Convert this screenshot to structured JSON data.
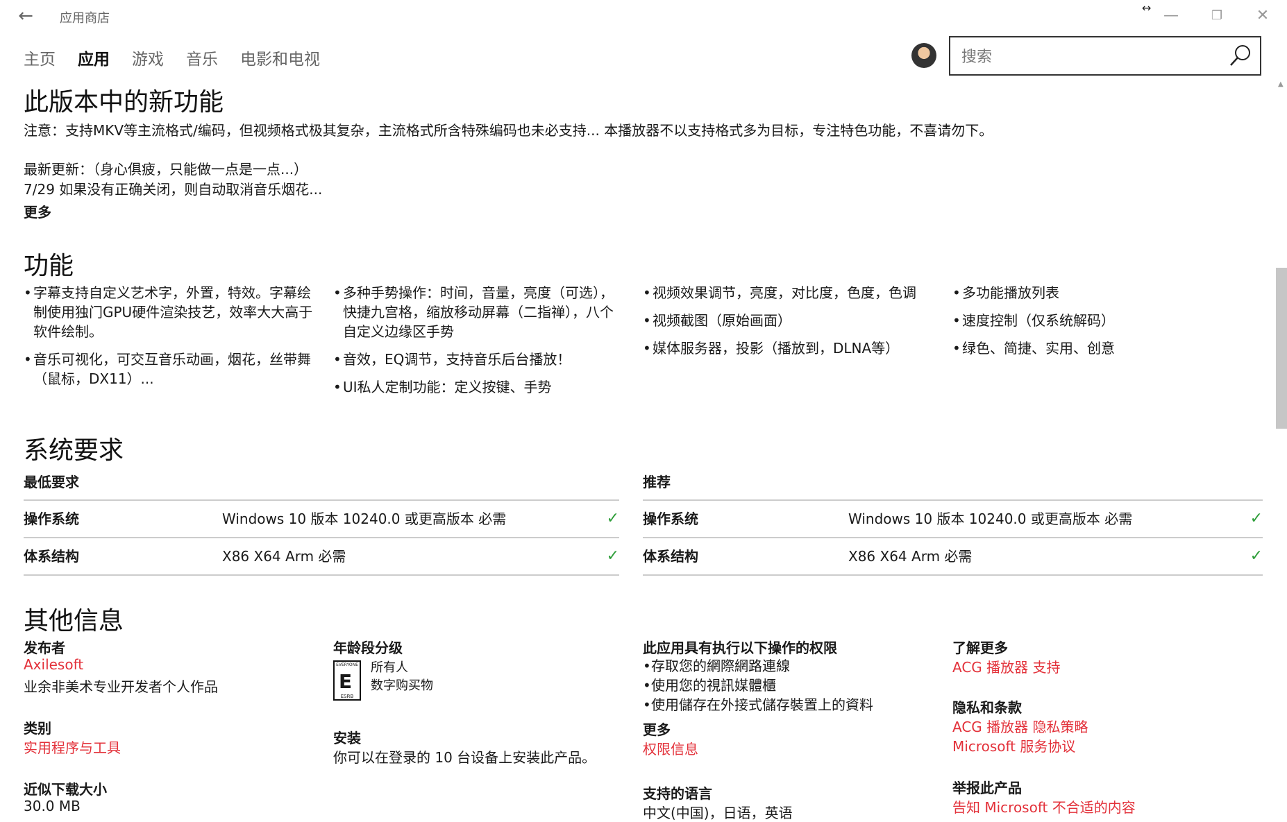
{
  "window": {
    "title": "应用商店"
  },
  "nav": {
    "tabs": [
      {
        "label": "主页"
      },
      {
        "label": "应用"
      },
      {
        "label": "游戏"
      },
      {
        "label": "音乐"
      },
      {
        "label": "电影和电视"
      }
    ],
    "active_index": 1
  },
  "search": {
    "placeholder": "搜索",
    "value": ""
  },
  "whats_new": {
    "heading": "此版本中的新功能",
    "note": "注意：支持MKV等主流格式/编码，但视频格式极其复杂，主流格式所含特殊编码也未必支持... 本播放器不以支持格式多为目标，专注特色功能，不喜请勿下。",
    "latest": "最新更新：（身心俱疲，只能做一点是一点...）",
    "update_line": "7/29 如果没有正确关闭，则自动取消音乐烟花...",
    "more": "更多"
  },
  "features": {
    "heading": "功能",
    "columns": [
      [
        "字幕支持自定义艺术字，外置，特效。字幕绘制使用独门GPU硬件渲染技艺，效率大大高于软件绘制。",
        "音乐可视化，可交互音乐动画，烟花，丝带舞（鼠标，DX11）..."
      ],
      [
        "多种手势操作：时间，音量，亮度（可选），快捷九宫格，缩放移动屏幕（二指禅），八个自定义边缘区手势",
        "音效，EQ调节，支持音乐后台播放！",
        "UI私人定制功能：定义按键、手势"
      ],
      [
        "视频效果调节，亮度，对比度，色度，色调",
        "视频截图（原始画面）",
        "媒体服务器，投影（播放到，DLNA等）"
      ],
      [
        "多功能播放列表",
        "速度控制（仅系统解码）",
        "绿色、简捷、实用、创意"
      ]
    ]
  },
  "sysreq": {
    "heading": "系统要求",
    "min": {
      "title": "最低要求",
      "rows": [
        {
          "key": "操作系统",
          "value": "Windows 10 版本 10240.0 或更高版本 必需"
        },
        {
          "key": "体系结构",
          "value": "X86 X64 Arm 必需"
        }
      ]
    },
    "rec": {
      "title": "推荐",
      "rows": [
        {
          "key": "操作系统",
          "value": "Windows 10 版本 10240.0 或更高版本 必需"
        },
        {
          "key": "体系结构",
          "value": "X86 X64 Arm 必需"
        }
      ]
    },
    "check_color": "#2e9e3a"
  },
  "other": {
    "heading": "其他信息",
    "publisher_label": "发布者",
    "publisher_link": "Axilesoft",
    "publisher_desc": "业余非美术专业开发者个人作品",
    "category_label": "类别",
    "category_link": "实用程序与工具",
    "size_label": "近似下载大小",
    "size_value": "30.0 MB",
    "rating_label": "年龄段分级",
    "rating_value": "所有人",
    "rating_sub": "数字购买物",
    "esrb_top": "EVERYONE",
    "esrb_letter": "E",
    "esrb_bottom": "ESRB",
    "install_label": "安装",
    "install_value": "你可以在登录的 10 台设备上安装此产品。",
    "permissions_label": "此应用具有执行以下操作的权限",
    "permissions": [
      "存取您的網際網路連線",
      "使用您的視訊媒體櫃",
      "使用儲存在外接式儲存裝置上的資料"
    ],
    "perm_more_label": "更多",
    "perm_more_link": "权限信息",
    "languages_label": "支持的语言",
    "languages_value": "中文(中国)，日语，英语",
    "learn_label": "了解更多",
    "learn_link": "ACG 播放器 支持",
    "privacy_label": "隐私和条款",
    "privacy_link1": "ACG 播放器 隐私策略",
    "privacy_link2": "Microsoft 服务协议",
    "report_label": "举报此产品",
    "report_link": "告知 Microsoft 不合适的内容"
  },
  "accent": "#e3313a"
}
